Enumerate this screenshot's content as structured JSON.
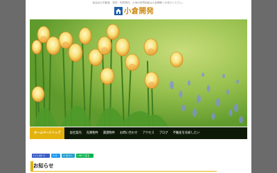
{
  "header": {
    "tagline": "仮谷区の不動産、賃貸・売買物件、土地の売買相談は小倉開発へお任せください。",
    "site_title": "小倉開発",
    "logo_icon": "house-icon"
  },
  "hero": {
    "image": "tulip-field-photo"
  },
  "nav": {
    "items": [
      {
        "label": "ホームページトップ",
        "active": true
      },
      {
        "label": "会社案内"
      },
      {
        "label": "売買物件"
      },
      {
        "label": "賃貸物件"
      },
      {
        "label": "お問い合わせ"
      },
      {
        "label": "アクセス"
      },
      {
        "label": "ブログ"
      },
      {
        "label": "不動産を売却したい"
      }
    ]
  },
  "social": {
    "facebook_label": "いいね! 0",
    "twitter_label": "0",
    "hatena_label": "ポスト",
    "line_label": "LINEで送る"
  },
  "section": {
    "title": "お知らせ"
  },
  "colors": {
    "accent": "#e4b20f",
    "title": "#d18a12",
    "nav_bg": "#0e1a08",
    "outer_bg": "#6b6b6b"
  }
}
